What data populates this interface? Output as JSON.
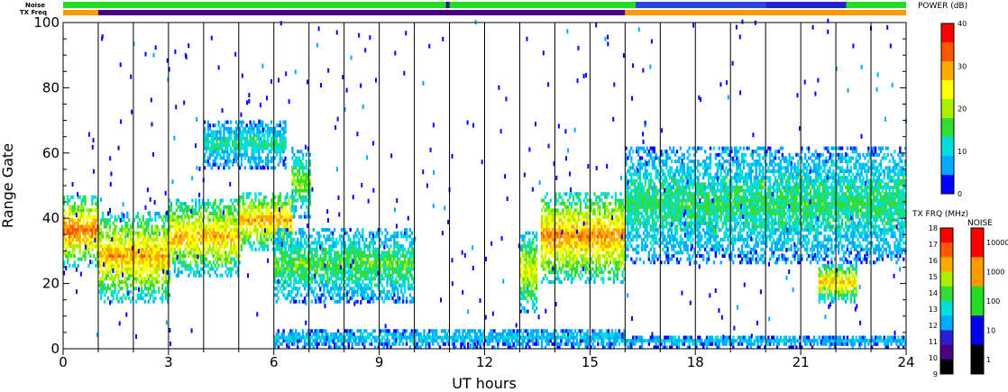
{
  "chart_data": {
    "type": "heatmap",
    "xlabel": "UT hours",
    "ylabel": "Range Gate",
    "x_ticks": [
      0,
      3,
      6,
      9,
      12,
      15,
      18,
      21,
      24
    ],
    "y_ticks": [
      0,
      20,
      40,
      60,
      80,
      100
    ],
    "xlim": [
      0,
      24
    ],
    "ylim": [
      0,
      100
    ],
    "vertical_scan_lines": true,
    "top_bars": {
      "noise_label": "Noise",
      "txfreq_label": "TX Freq",
      "noise": [
        {
          "from": 0.0,
          "to": 10.9,
          "color": "#22dd22"
        },
        {
          "from": 10.9,
          "to": 11.0,
          "color": "#0000aa"
        },
        {
          "from": 11.0,
          "to": 16.3,
          "color": "#22dd22"
        },
        {
          "from": 16.3,
          "to": 20.0,
          "color": "#2a45d8"
        },
        {
          "from": 20.0,
          "to": 22.3,
          "color": "#2222cc"
        },
        {
          "from": 22.3,
          "to": 24.0,
          "color": "#22dd22"
        }
      ],
      "txfreq": [
        {
          "from": 0.0,
          "to": 1.0,
          "color": "#ff9900"
        },
        {
          "from": 1.0,
          "to": 16.0,
          "color": "#4b0082"
        },
        {
          "from": 16.0,
          "to": 24.0,
          "color": "#ff9900"
        }
      ]
    },
    "power_colorbar": {
      "title": "POWER (dB)",
      "ticks": [
        "0",
        "10",
        "20",
        "30",
        "40"
      ],
      "colors": [
        "#0000ff",
        "#00aaff",
        "#00dddd",
        "#33dd33",
        "#aaee00",
        "#ffff00",
        "#ffaa00",
        "#ff5500",
        "#ff0000"
      ]
    },
    "txfreq_colorbar": {
      "title": "TX FRQ (MHz)",
      "ticks": [
        "9",
        "10",
        "11",
        "12",
        "13",
        "14",
        "15",
        "16",
        "17",
        "18"
      ],
      "colors": [
        "#000000",
        "#4b0082",
        "#2a1fd0",
        "#00aaff",
        "#00dddd",
        "#33dd33",
        "#aaee00",
        "#ffaa00",
        "#ff5500",
        "#ff0000"
      ]
    },
    "noise_colorbar": {
      "title": "NOISE",
      "ticks": [
        "1",
        "10",
        "100",
        "1000",
        "10000"
      ],
      "colors": [
        "#000000",
        "#0000ee",
        "#22dd22",
        "#ff9900",
        "#ff0000"
      ]
    },
    "echo_regions": [
      {
        "t0": 0.0,
        "t1": 1.0,
        "g0": 25,
        "g1": 47,
        "peak": 34
      },
      {
        "t0": 1.0,
        "t1": 3.0,
        "g0": 14,
        "g1": 42,
        "peak": 30
      },
      {
        "t0": 3.0,
        "t1": 5.0,
        "g0": 22,
        "g1": 46,
        "peak": 29
      },
      {
        "t0": 5.0,
        "t1": 6.5,
        "g0": 30,
        "g1": 48,
        "peak": 31
      },
      {
        "t0": 6.5,
        "t1": 7.0,
        "g0": 40,
        "g1": 62,
        "peak": 18
      },
      {
        "t0": 4.0,
        "t1": 6.3,
        "g0": 55,
        "g1": 70,
        "peak": 12
      },
      {
        "t0": 6.0,
        "t1": 10.0,
        "g0": 14,
        "g1": 37,
        "peak": 16
      },
      {
        "t0": 13.0,
        "t1": 13.5,
        "g0": 11,
        "g1": 36,
        "peak": 24
      },
      {
        "t0": 13.6,
        "t1": 16.0,
        "g0": 20,
        "g1": 48,
        "peak": 32
      },
      {
        "t0": 16.0,
        "t1": 24.0,
        "g0": 26,
        "g1": 62,
        "peak": 14
      },
      {
        "t0": 21.5,
        "t1": 22.6,
        "g0": 14,
        "g1": 26,
        "peak": 28
      },
      {
        "t0": 6.0,
        "t1": 16.0,
        "g0": 0,
        "g1": 6,
        "peak": 8
      },
      {
        "t0": 16.0,
        "t1": 24.0,
        "g0": 0,
        "g1": 4,
        "peak": 7
      }
    ]
  }
}
